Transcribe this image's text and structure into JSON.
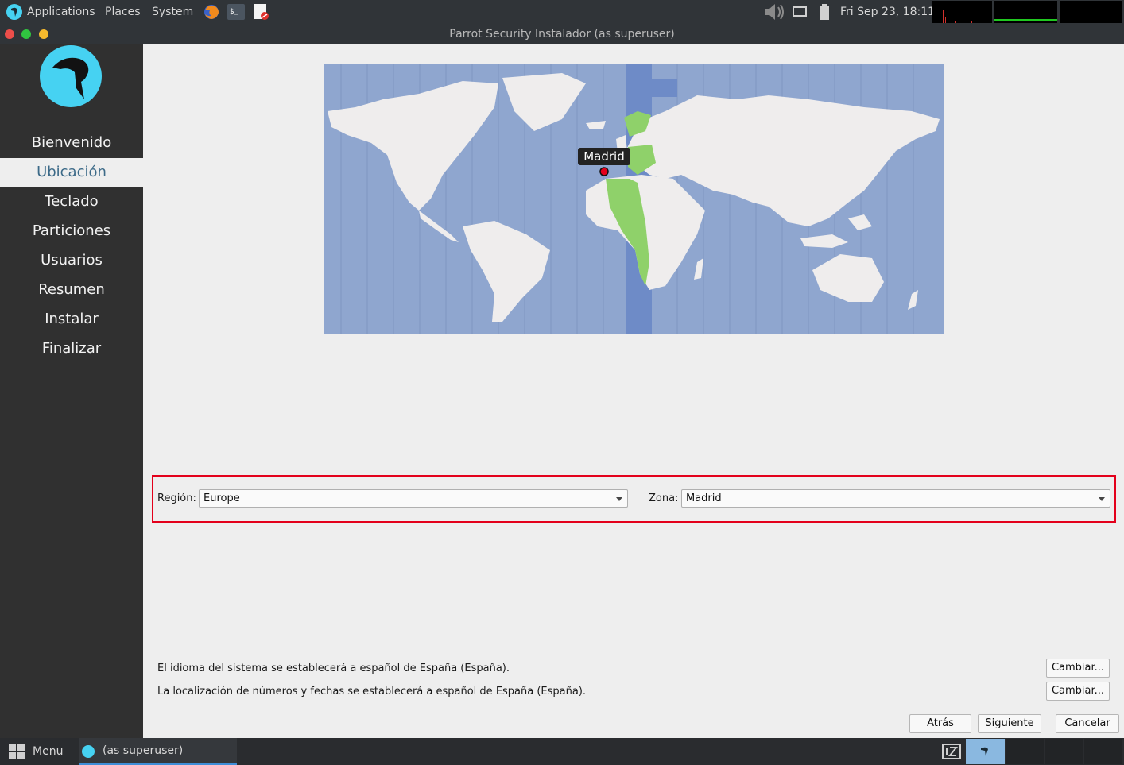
{
  "top_panel": {
    "applications": "Applications",
    "places": "Places",
    "system": "System",
    "clock": "Fri Sep 23, 18:11",
    "icons": [
      "parrot-logo-icon",
      "firefox-icon",
      "terminal-icon",
      "text-editor-icon",
      "volume-icon",
      "display-icon",
      "battery-icon"
    ]
  },
  "window": {
    "title": "Parrot Security Instalador (as superuser)"
  },
  "sidebar": {
    "steps": [
      "Bienvenido",
      "Ubicación",
      "Teclado",
      "Particiones",
      "Usuarios",
      "Resumen",
      "Instalar",
      "Finalizar"
    ],
    "active_step": "Ubicación"
  },
  "map": {
    "selected_city": "Madrid"
  },
  "timezone": {
    "region_label": "Región:",
    "region_value": "Europe",
    "zone_label": "Zona:",
    "zone_value": "Madrid"
  },
  "locale": {
    "language_text": "El idioma del sistema se establecerá a español de España (España).",
    "numbers_text": "La localización de números y fechas se establecerá a español de España (España).",
    "change_label": "Cambiar..."
  },
  "nav": {
    "back": "Atrás",
    "next": "Siguiente",
    "cancel": "Cancelar"
  },
  "bottom_panel": {
    "menu": "Menu",
    "task": "(as superuser)"
  },
  "colors": {
    "accent": "#46d2f2",
    "highlight_border": "#e3001b",
    "timezone_highlight": "#8fd16a"
  }
}
